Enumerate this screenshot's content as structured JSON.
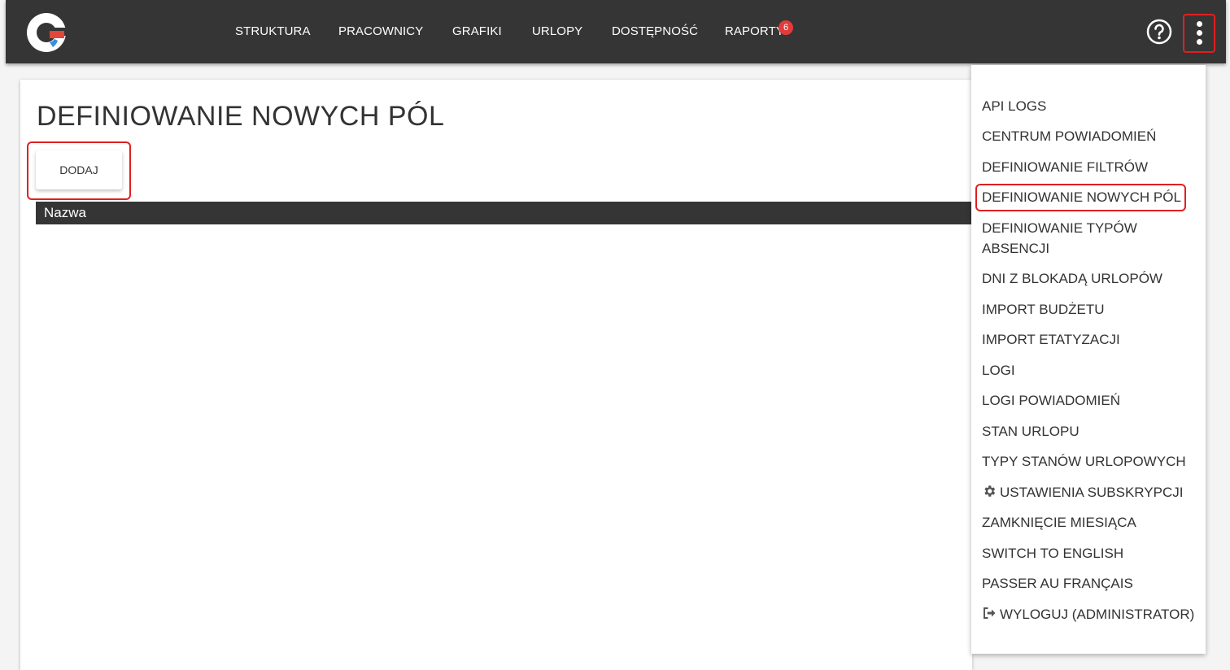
{
  "header": {
    "nav": [
      "STRUKTURA",
      "PRACOWNICY",
      "GRAFIKI",
      "URLOPY",
      "DOSTĘPNOŚĆ",
      "RAPORTY"
    ],
    "raporty_badge": "6"
  },
  "page": {
    "title": "DEFINIOWANIE NOWYCH PÓL",
    "add_button": "DODAJ",
    "table_columns": [
      "Nazwa"
    ]
  },
  "menu": {
    "items": [
      "API LOGS",
      "CENTRUM POWIADOMIEŃ",
      "DEFINIOWANIE FILTRÓW",
      "DEFINIOWANIE NOWYCH PÓL",
      "DEFINIOWANIE TYPÓW",
      "IMPORT BUDŻETU",
      "IMPORT ETATYZACJI",
      "LOGI",
      "LOGI POWIADOMIEŃ",
      "STAN URLOPU",
      "TYPY STANÓW URLOPOWYCH",
      "USTAWIENIA SUBSKRYPCJI",
      "ZAMKNIĘCIE MIESIĄCA",
      "SWITCH TO ENGLISH",
      "PASSER AU FRANÇAIS",
      "WYLOGUJ (ADMINISTRATOR)"
    ],
    "absencji_line": "ABSENCJI",
    "blokada_item": "DNI Z BLOKADĄ URLOPÓW",
    "active_item": "DEFINIOWANIE NOWYCH PÓL"
  },
  "colors": {
    "topbar": "#353535",
    "highlight": "#e02020",
    "badge": "#e33b3b"
  },
  "icons": [
    "app-logo",
    "help-icon",
    "kebab-menu-icon",
    "gear-icon",
    "logout-icon"
  ]
}
